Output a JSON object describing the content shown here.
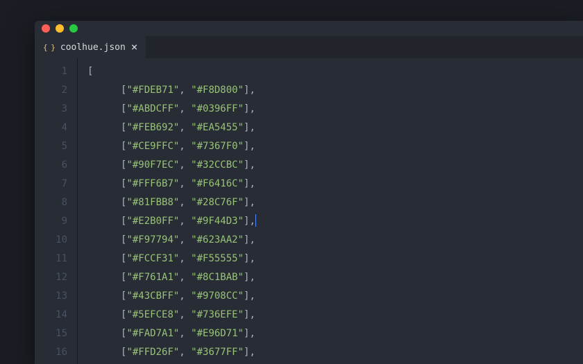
{
  "tab": {
    "filename": "coolhue.json",
    "icon_label": "{ }"
  },
  "opening_bracket": "[",
  "cursor_line_index": 8,
  "lines": [
    {
      "num": 1
    },
    {
      "num": 2,
      "pair": [
        "#FDEB71",
        "#F8D800"
      ]
    },
    {
      "num": 3,
      "pair": [
        "#ABDCFF",
        "#0396FF"
      ]
    },
    {
      "num": 4,
      "pair": [
        "#FEB692",
        "#EA5455"
      ]
    },
    {
      "num": 5,
      "pair": [
        "#CE9FFC",
        "#7367F0"
      ]
    },
    {
      "num": 6,
      "pair": [
        "#90F7EC",
        "#32CCBC"
      ]
    },
    {
      "num": 7,
      "pair": [
        "#FFF6B7",
        "#F6416C"
      ]
    },
    {
      "num": 8,
      "pair": [
        "#81FBB8",
        "#28C76F"
      ]
    },
    {
      "num": 9,
      "pair": [
        "#E2B0FF",
        "#9F44D3"
      ]
    },
    {
      "num": 10,
      "pair": [
        "#F97794",
        "#623AA2"
      ]
    },
    {
      "num": 11,
      "pair": [
        "#FCCF31",
        "#F55555"
      ]
    },
    {
      "num": 12,
      "pair": [
        "#F761A1",
        "#8C1BAB"
      ]
    },
    {
      "num": 13,
      "pair": [
        "#43CBFF",
        "#9708CC"
      ]
    },
    {
      "num": 14,
      "pair": [
        "#5EFCE8",
        "#736EFE"
      ]
    },
    {
      "num": 15,
      "pair": [
        "#FAD7A1",
        "#E96D71"
      ]
    },
    {
      "num": 16,
      "pair": [
        "#FFD26F",
        "#3677FF"
      ]
    }
  ]
}
